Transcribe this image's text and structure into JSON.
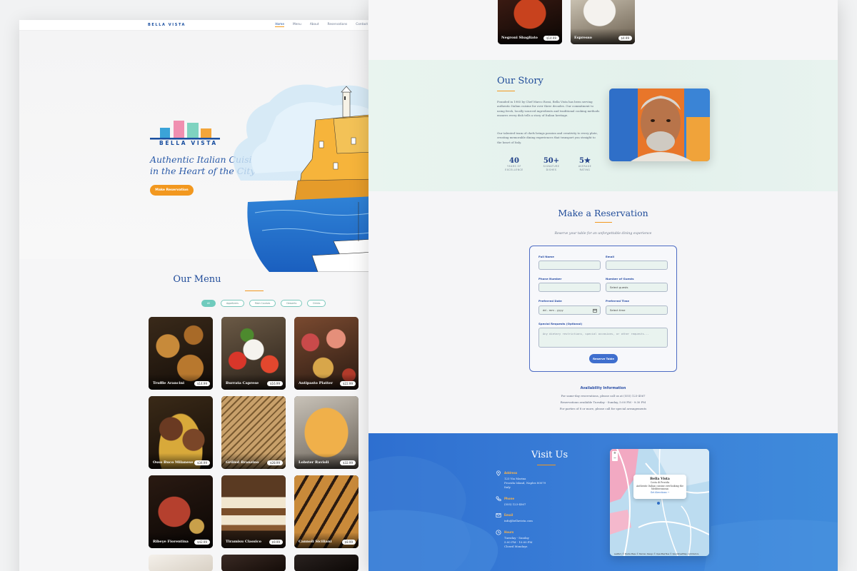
{
  "left_page": {
    "nav": {
      "logo": "BELLA VISTA",
      "links": [
        "Home",
        "Menu",
        "About",
        "Reservations",
        "Contact"
      ]
    },
    "hero": {
      "logo_text": "BELLA VISTA",
      "tagline": "Authentic Italian Cuisine in the Heart of the City",
      "button": "Make Reservation"
    },
    "menu": {
      "title": "Our Menu",
      "filters": [
        "All",
        "Appetizers",
        "Main Courses",
        "Desserts",
        "Drinks"
      ],
      "items": [
        {
          "name": "Truffle Arancini",
          "price": "$14.99"
        },
        {
          "name": "Burrata Caprese",
          "price": "$16.99"
        },
        {
          "name": "Antipasto Platter",
          "price": "$22.99"
        },
        {
          "name": "Osso Buco Milanese",
          "price": "$34.99"
        },
        {
          "name": "Grilled Branzino",
          "price": "$28.99"
        },
        {
          "name": "Lobster Ravioli",
          "price": "$32.99"
        },
        {
          "name": "Ribeye Fiorentina",
          "price": "$42.99"
        },
        {
          "name": "Tiramisu Classico",
          "price": "$9.99"
        },
        {
          "name": "Cannoli Siciliani",
          "price": "$8.99"
        }
      ]
    }
  },
  "right_page": {
    "drinks": [
      {
        "name": "Negroni Sbagliato",
        "price": "$14.99"
      },
      {
        "name": "Espresso",
        "price": "$4.99"
      }
    ],
    "story": {
      "title": "Our Story",
      "p1": "Founded in 1985 by Chef Marco Rossi, Bella Vista has been serving authentic Italian cuisine for over three decades. Our commitment to using fresh, locally-sourced ingredients and traditional cooking methods ensures every dish tells a story of Italian heritage.",
      "p2": "Our talented team of chefs brings passion and creativity to every plate, creating memorable dining experiences that transport you straight to the heart of Italy.",
      "stats": [
        {
          "num": "40",
          "label1": "YEARS OF",
          "label2": "EXCELLENCE"
        },
        {
          "num": "50+",
          "label1": "SIGNATURE",
          "label2": "DISHES"
        },
        {
          "num": "5★",
          "label1": "AVERAGE",
          "label2": "RATING"
        }
      ]
    },
    "reservation": {
      "title": "Make a Reservation",
      "subtitle": "Reserve your table for an unforgettable dining experience",
      "labels": {
        "full_name": "Full Name",
        "email": "Email",
        "phone": "Phone Number",
        "guests": "Number of Guests",
        "date": "Preferred Date",
        "time": "Preferred Time",
        "requests": "Special Requests (Optional)"
      },
      "guests_value": "Select guests",
      "date_value": "dd - mm - yyyy",
      "time_value": "Select time",
      "requests_placeholder": "Any dietary restrictions, special occasions, or other requests...",
      "button": "Reserve Table",
      "availability_title": "Availability Information",
      "availability_lines": [
        "For same-day reservations, please call us at (555) 123-4567",
        "Reservations available Tuesday - Sunday, 5:00 PM - 9:30 PM",
        "For parties of 8 or more, please call for special arrangements"
      ]
    },
    "visit": {
      "title": "Visit Us",
      "address_label": "Address",
      "address_lines": [
        "123 Via Marina",
        "Procida Island, Naples 80079",
        "Italy"
      ],
      "phone_label": "Phone",
      "phone": "(555) 123-4567",
      "email_label": "Email",
      "email": "info@bellavista.com",
      "hours_label": "Hours",
      "hours_lines": [
        "Tuesday - Sunday",
        "5:00 PM - 10:00 PM",
        "Closed Mondays"
      ],
      "map_popup_title": "Bella Vista",
      "map_popup_sub": "Costa di Procida",
      "map_popup_desc1": "Authentic Italian cuisine overlooking the",
      "map_popup_desc2": "Mediterranean",
      "map_popup_link": "Get directions →",
      "map_zoom_in": "+",
      "map_zoom_out": "−",
      "map_credit": "Leaflet | © Stadia Maps © Stamen Design © OpenMapTiles © OpenStreetMap contributors"
    }
  },
  "colors": {
    "primary_blue": "#1f4b99",
    "accent_orange": "#f2981f",
    "mint": "#6fcbbd"
  }
}
